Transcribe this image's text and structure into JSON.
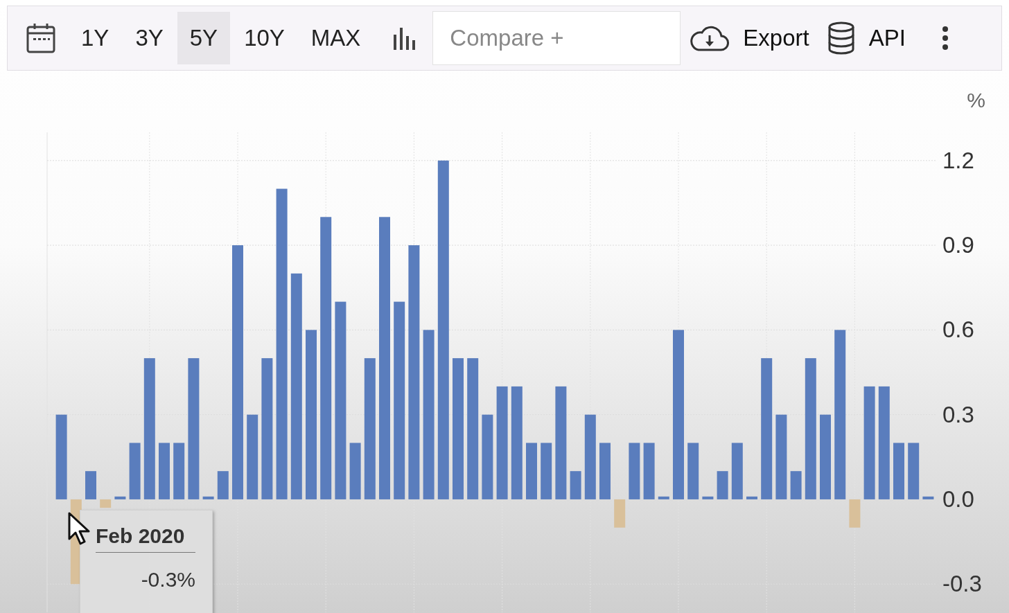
{
  "toolbar": {
    "periods": [
      {
        "label": "1Y",
        "selected": false
      },
      {
        "label": "3Y",
        "selected": false
      },
      {
        "label": "5Y",
        "selected": true
      },
      {
        "label": "10Y",
        "selected": false
      },
      {
        "label": "MAX",
        "selected": false
      }
    ],
    "compare": {
      "placeholder": "Compare +"
    },
    "export": "Export",
    "api": "API"
  },
  "chart": {
    "unit": "%",
    "chart_data": {
      "type": "bar",
      "grid": true,
      "ylim": [
        -0.4,
        1.3
      ],
      "yticks": [
        -0.3,
        {
          "value": 0,
          "label": "0.0"
        },
        0.3,
        0.6,
        0.9,
        1.2
      ],
      "series": [
        {
          "color": "#5a7dbd",
          "values": [
            0.3,
            null,
            0.1,
            null,
            0.01,
            0.2,
            0.5,
            0.2,
            0.2,
            0.5,
            0.01,
            0.1,
            0.9,
            0.3,
            0.5,
            1.1,
            0.8,
            0.6,
            1.0,
            0.7,
            0.2,
            0.5,
            1.0,
            0.7,
            0.9,
            0.6,
            1.2,
            0.5,
            0.5,
            0.3,
            0.4,
            0.4,
            0.2,
            0.2,
            0.4,
            0.1,
            0.3,
            0.2,
            null,
            0.2,
            0.2,
            0.01,
            0.6,
            0.2,
            0.01,
            0.1,
            0.2,
            0.01,
            0.5,
            0.3,
            0.1,
            0.5,
            0.3,
            0.6,
            null,
            0.4,
            0.4,
            0.2,
            0.2,
            0.01
          ]
        },
        {
          "color": "#d9c09a",
          "values": [
            null,
            -0.3,
            null,
            -0.03,
            null,
            null,
            null,
            null,
            null,
            null,
            null,
            null,
            null,
            null,
            null,
            null,
            null,
            null,
            null,
            null,
            null,
            null,
            null,
            null,
            null,
            null,
            null,
            null,
            null,
            null,
            null,
            null,
            null,
            null,
            null,
            null,
            null,
            null,
            -0.1,
            null,
            null,
            null,
            null,
            null,
            null,
            null,
            null,
            null,
            null,
            null,
            null,
            null,
            null,
            null,
            -0.1,
            null,
            null,
            null,
            null,
            null
          ]
        }
      ]
    },
    "tooltip": {
      "title": "Feb 2020",
      "value": "-0.3%"
    }
  }
}
